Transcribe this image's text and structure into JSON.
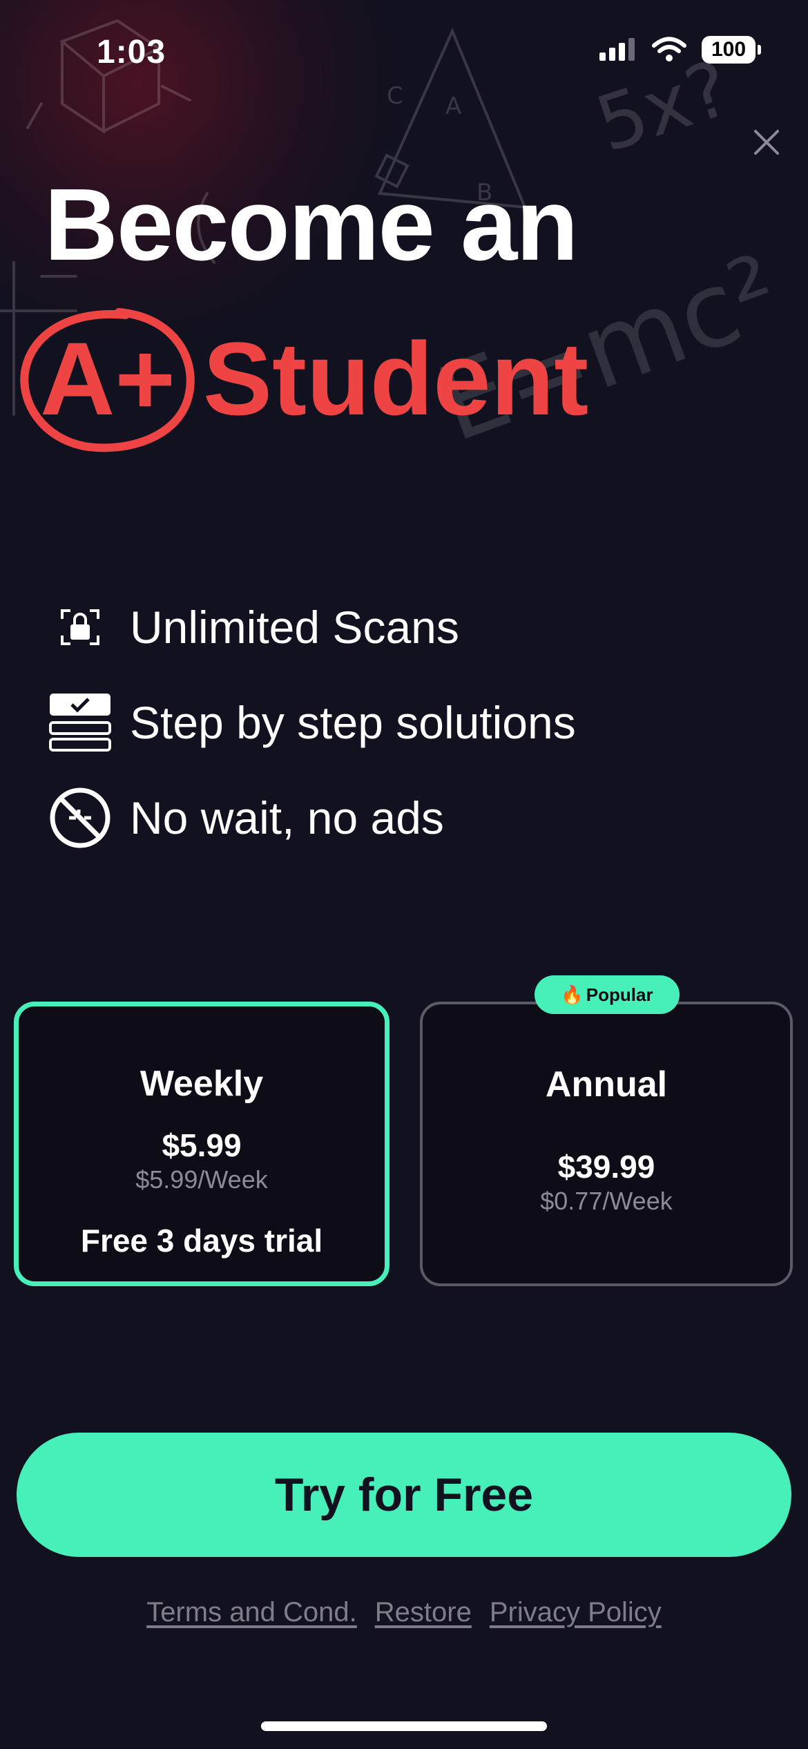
{
  "status_bar": {
    "time": "1:03",
    "battery": "100"
  },
  "header": {
    "line1": "Become an",
    "grade": "A+",
    "line2": "Student"
  },
  "doodles": [
    "5x?",
    "E=mc²",
    "A",
    "B",
    "C"
  ],
  "features": [
    {
      "icon": "scan-lock-icon",
      "label": "Unlimited Scans"
    },
    {
      "icon": "steps-list-icon",
      "label": "Step by step solutions"
    },
    {
      "icon": "no-ads-icon",
      "label": "No wait, no ads"
    }
  ],
  "plans": {
    "weekly": {
      "name": "Weekly",
      "price": "$5.99",
      "per": "$5.99/Week",
      "trial": "Free 3 days trial",
      "selected": true
    },
    "annual": {
      "name": "Annual",
      "price": "$39.99",
      "per": "$0.77/Week",
      "badge_emoji": "🔥",
      "badge": "Popular",
      "selected": false
    }
  },
  "cta": {
    "label": "Try for Free"
  },
  "footer_links": {
    "terms": "Terms and Cond.",
    "restore": "Restore",
    "privacy": "Privacy Policy"
  },
  "colors": {
    "accent": "#46f0b8",
    "red": "#ef4444",
    "background": "#12111f"
  }
}
